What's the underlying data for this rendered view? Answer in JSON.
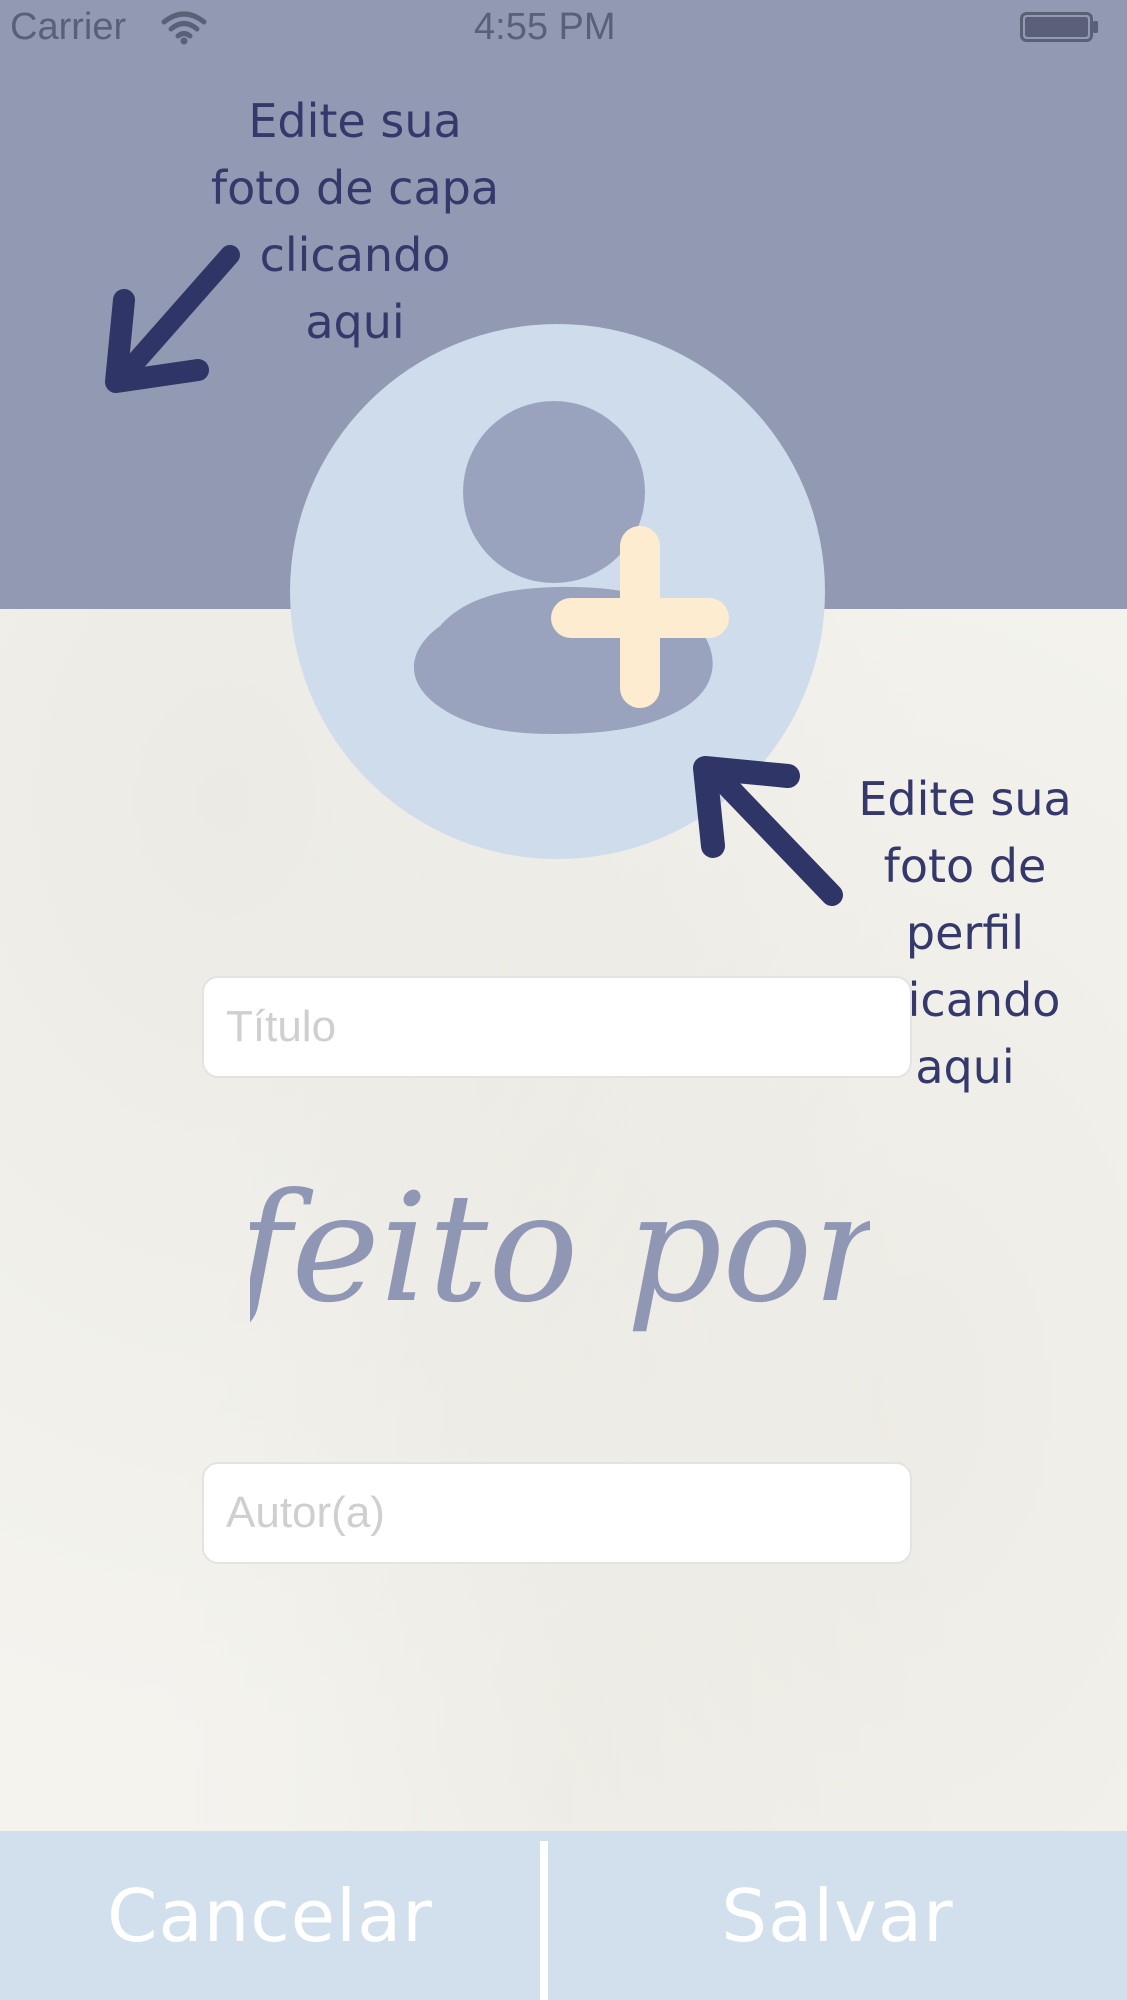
{
  "status_bar": {
    "carrier": "Carrier",
    "time": "4:55 PM"
  },
  "annotations": {
    "cover_hint": [
      "Edite sua",
      "foto de capa",
      "clicando",
      "aqui"
    ],
    "profile_hint": [
      "Edite sua",
      "foto de",
      "perfil",
      "clicando",
      "aqui"
    ]
  },
  "form": {
    "title_placeholder": "Título",
    "title_value": "",
    "author_placeholder": "Autor(a)",
    "author_value": "",
    "made_by_label": "feito por"
  },
  "buttons": {
    "cancel_label": "Cancelar",
    "save_label": "Salvar"
  },
  "colors": {
    "cover_background": "#9299b2",
    "avatar_background": "#cfdcec",
    "avatar_figure": "#9aa3bd",
    "plus_badge": "#fdeccf",
    "annotation_text": "#34386a",
    "bottom_bar": "#d2e0ee",
    "page_background": "#f4f3ee"
  },
  "icons": {
    "wifi": "wifi-icon",
    "battery": "battery-icon",
    "profile_placeholder": "user-placeholder-icon",
    "add": "plus-icon",
    "cover_arrow": "arrow-down-left-icon",
    "profile_arrow": "arrow-up-left-icon"
  }
}
